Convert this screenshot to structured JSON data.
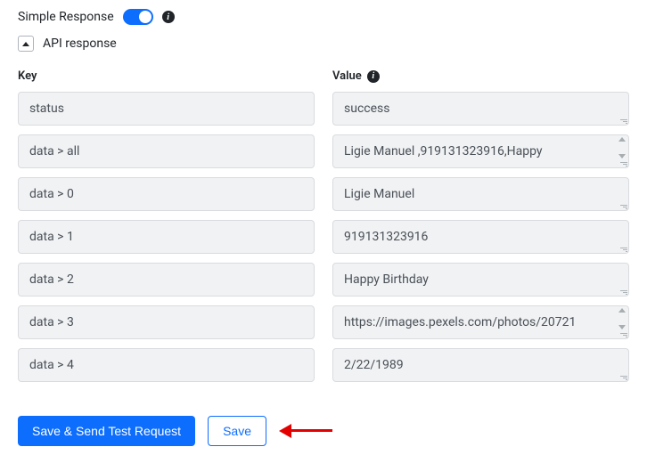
{
  "header": {
    "label": "Simple Response"
  },
  "section": {
    "title": "API response"
  },
  "table": {
    "key_header": "Key",
    "value_header": "Value",
    "rows": [
      {
        "key": "status",
        "value": "success",
        "scroll": false
      },
      {
        "key": "data > all",
        "value": "Ligie Manuel ,919131323916,Happy",
        "scroll": true
      },
      {
        "key": "data > 0",
        "value": "Ligie Manuel",
        "scroll": false
      },
      {
        "key": "data > 1",
        "value": "919131323916",
        "scroll": false
      },
      {
        "key": "data > 2",
        "value": "Happy Birthday",
        "scroll": false
      },
      {
        "key": "data > 3",
        "value": "https://images.pexels.com/photos/20721",
        "scroll": true
      },
      {
        "key": "data > 4",
        "value": "2/22/1989",
        "scroll": false
      }
    ]
  },
  "footer": {
    "save_send": "Save & Send Test Request",
    "save": "Save"
  }
}
